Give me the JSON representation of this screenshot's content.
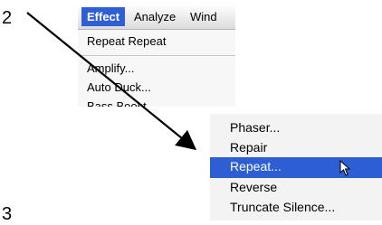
{
  "steps": {
    "a": "2",
    "b": "3"
  },
  "menu_top": {
    "bar_items": [
      "Effect",
      "Analyze",
      "Wind"
    ],
    "items": [
      "Repeat Repeat",
      "Amplify...",
      "Auto Duck...",
      "Bass Boost..."
    ]
  },
  "menu_bottom": {
    "items": [
      "Phaser...",
      "Repair",
      "Repeat...",
      "Reverse",
      "Truncate Silence..."
    ],
    "highlighted": "Repeat..."
  },
  "icons": {
    "cursor": "arrow-pointer-icon"
  },
  "colors": {
    "selection": "#2d5ed3"
  }
}
